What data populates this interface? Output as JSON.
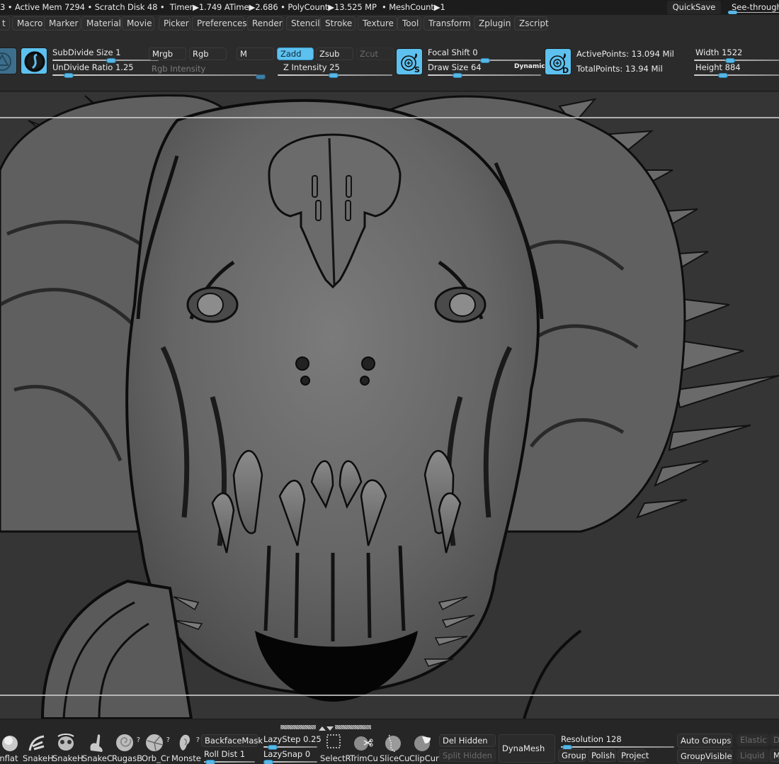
{
  "status": {
    "prefix": "3 •",
    "active_mem": "Active Mem 7294",
    "scratch_disk": "Scratch Disk 48",
    "timer": "Timer▶1.749",
    "atime": "ATime▶2.686",
    "polycount": "PolyCount▶13.525 MP",
    "meshcount": "MeshCount▶1",
    "quicksave": "QuickSave",
    "see_through": "See-through",
    "see_through_value": 0
  },
  "menu": [
    "t",
    "Macro",
    "Marker",
    "Material",
    "Movie",
    "Picker",
    "Preferences",
    "Render",
    "Stencil",
    "Stroke",
    "Texture",
    "Tool",
    "Transform",
    "Zplugin",
    "Zscript"
  ],
  "shelf": {
    "subdivide_size": "SubDivide Size 1",
    "undivide_ratio": "UnDivide Ratio 1.25",
    "mrgb": "Mrgb",
    "rgb": "Rgb",
    "m": "M",
    "rgb_intensity": "Rgb Intensity",
    "zadd": "Zadd",
    "zsub": "Zsub",
    "zcut": "Zcut",
    "z_intensity": "Z Intensity 25",
    "focal_shift": "Focal Shift 0",
    "draw_size": "Draw Size 64",
    "dynamic": "Dynamic",
    "active_points": "ActivePoints: 13.094 Mil",
    "total_points": "TotalPoints: 13.94 Mil",
    "width": "Width 1522",
    "height": "Height 884",
    "icons": {
      "tool_left": "sphere-tool-icon",
      "material": "matcap-material-icon",
      "draw_s": "draw-size-s-icon",
      "draw_d": "draw-dynamic-d-icon"
    }
  },
  "bottom": {
    "brushes": [
      "Inflat",
      "SnakeH",
      "SnakeH",
      "SnakeC",
      "RugasB",
      "Orb_Cr",
      "Monste"
    ],
    "backface_mask": "BackfaceMask",
    "roll_dist": "Roll Dist 1",
    "lazy_step": "LazyStep 0.25",
    "lazy_snap": "LazySnap 0",
    "tools": [
      "SelectRe",
      "TrimCu",
      "SliceCu",
      "ClipCur"
    ],
    "del_hidden": "Del Hidden",
    "split_hidden": "Split Hidden",
    "dynamesh": "DynaMesh",
    "resolution": "Resolution 128",
    "groups": "Groups",
    "polish": "Polish",
    "project": "Project",
    "auto_groups": "Auto Groups",
    "group_visible": "GroupVisible",
    "elastic": "Elastic",
    "liquid": "Liquid",
    "d_cut": "D",
    "m_cut": "M"
  },
  "colors": {
    "accent": "#5dc1ef",
    "canvas": "#353535",
    "panel": "#2b2b2b",
    "status": "#1c1c1c"
  }
}
